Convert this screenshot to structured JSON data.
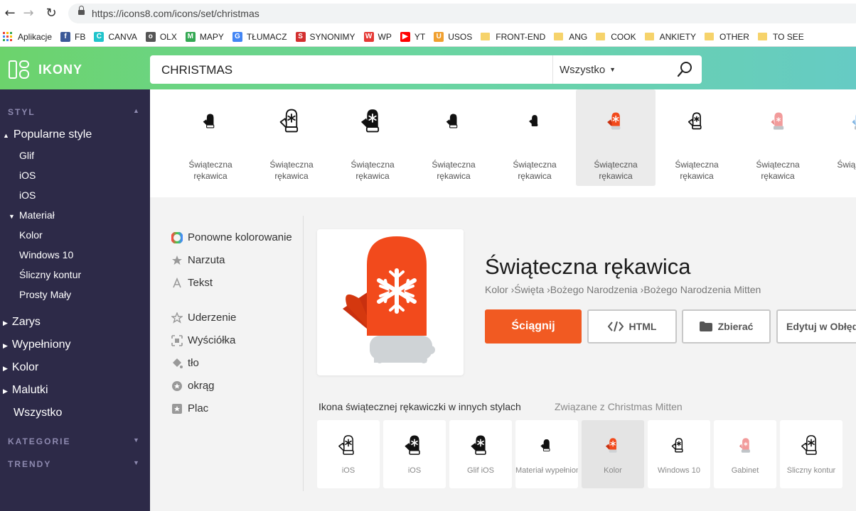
{
  "browser": {
    "url": "https://icons8.com/icons/set/christmas",
    "bookmarks": [
      {
        "label": "Aplikacje",
        "icon": "apps-grid"
      },
      {
        "label": "FB",
        "icon": "facebook",
        "color": "#3b5998",
        "glyph": "f"
      },
      {
        "label": "CANVA",
        "icon": "canva",
        "color": "#20c4cb",
        "glyph": "C"
      },
      {
        "label": "OLX",
        "icon": "olx",
        "color": "#555555",
        "glyph": "o"
      },
      {
        "label": "MAPY",
        "icon": "maps",
        "color": "#34a853",
        "glyph": "M"
      },
      {
        "label": "TŁUMACZ",
        "icon": "translate",
        "color": "#4285f4",
        "glyph": "G"
      },
      {
        "label": "SYNONIMY",
        "icon": "synonimy",
        "color": "#d32f2f",
        "glyph": "S"
      },
      {
        "label": "WP",
        "icon": "wp",
        "color": "#e53935",
        "glyph": "W"
      },
      {
        "label": "YT",
        "icon": "youtube",
        "color": "#ff0000",
        "glyph": "▶"
      },
      {
        "label": "USOS",
        "icon": "usos",
        "color": "#f0a030",
        "glyph": "U"
      },
      {
        "label": "FRONT-END",
        "icon": "folder"
      },
      {
        "label": "ANG",
        "icon": "folder"
      },
      {
        "label": "COOK",
        "icon": "folder"
      },
      {
        "label": "ANKIETY",
        "icon": "folder"
      },
      {
        "label": "OTHER",
        "icon": "folder"
      },
      {
        "label": "TO SEE",
        "icon": "folder"
      }
    ]
  },
  "header": {
    "logo": "IKONY",
    "search_value": "CHRISTMAS",
    "filter": "Wszystko"
  },
  "sidebar": {
    "styl_head": "STYL",
    "popular": "Popularne style",
    "popular_items": [
      "Glif",
      "iOS",
      "iOS"
    ],
    "material": "Materiał",
    "material_items": [
      "Kolor",
      "Windows 10",
      "Śliczny kontur",
      "Prosty Mały"
    ],
    "groups": [
      "Zarys",
      "Wypełniony",
      "Kolor",
      "Malutki"
    ],
    "all": "Wszystko",
    "kategorie": "KATEGORIE",
    "trendy": "TRENDY"
  },
  "strip": {
    "cards": [
      {
        "label": "Świąteczna rękawica",
        "style": "small-black"
      },
      {
        "label": "Świąteczna rękawica",
        "style": "outline"
      },
      {
        "label": "Świąteczna rękawica",
        "style": "filled-black"
      },
      {
        "label": "Świąteczna rękawica",
        "style": "small-black"
      },
      {
        "label": "Świąteczna rękawica",
        "style": "tiny-black"
      },
      {
        "label": "Świąteczna rękawica",
        "style": "color"
      },
      {
        "label": "Świąteczna rękawica",
        "style": "outline-small"
      },
      {
        "label": "Świąteczna rękawica",
        "style": "pink"
      },
      {
        "label": "Świą rękaw",
        "style": "blue"
      }
    ]
  },
  "options": [
    {
      "label": "Ponowne kolorowanie",
      "icon": "color-wheel-icon"
    },
    {
      "label": "Narzuta",
      "icon": "overlay-star-icon"
    },
    {
      "label": "Tekst",
      "icon": "text-a-icon"
    },
    {
      "label": "Uderzenie",
      "icon": "stroke-star-icon"
    },
    {
      "label": "Wyściółka",
      "icon": "padding-icon"
    },
    {
      "label": "tło",
      "icon": "paint-bucket-icon"
    },
    {
      "label": "okrąg",
      "icon": "circle-star-icon"
    },
    {
      "label": "Plac",
      "icon": "square-star-icon"
    }
  ],
  "detail": {
    "title": "Świąteczna rękawica",
    "breadcrumb": "Kolor ›Święta ›Bożego Narodzenia ›Bożego Narodzenia Mitten",
    "download": "Ściągnij",
    "html": "HTML",
    "collect": "Zbierać",
    "edit": "Edytuj w Obłędzie"
  },
  "other_styles": {
    "title": "Ikona świątecznej rękawiczki w innych stylach",
    "related": "Związane z Christmas Mitten",
    "tiles": [
      {
        "label": "iOS",
        "style": "outline"
      },
      {
        "label": "iOS",
        "style": "filled-black"
      },
      {
        "label": "Glif iOS",
        "style": "filled-black"
      },
      {
        "label": "Materiał wypełniony",
        "style": "small-black"
      },
      {
        "label": "Kolor",
        "style": "color"
      },
      {
        "label": "Windows 10",
        "style": "outline-small"
      },
      {
        "label": "Gabinet",
        "style": "pink"
      },
      {
        "label": "Śliczny kontur",
        "style": "outline"
      }
    ]
  },
  "colors": {
    "accent": "#f15a22",
    "sidebar": "#2d2a48",
    "mitten_orange": "#f24a1c",
    "mitten_dark": "#c9300f",
    "cuff": "#cfd3d6"
  }
}
